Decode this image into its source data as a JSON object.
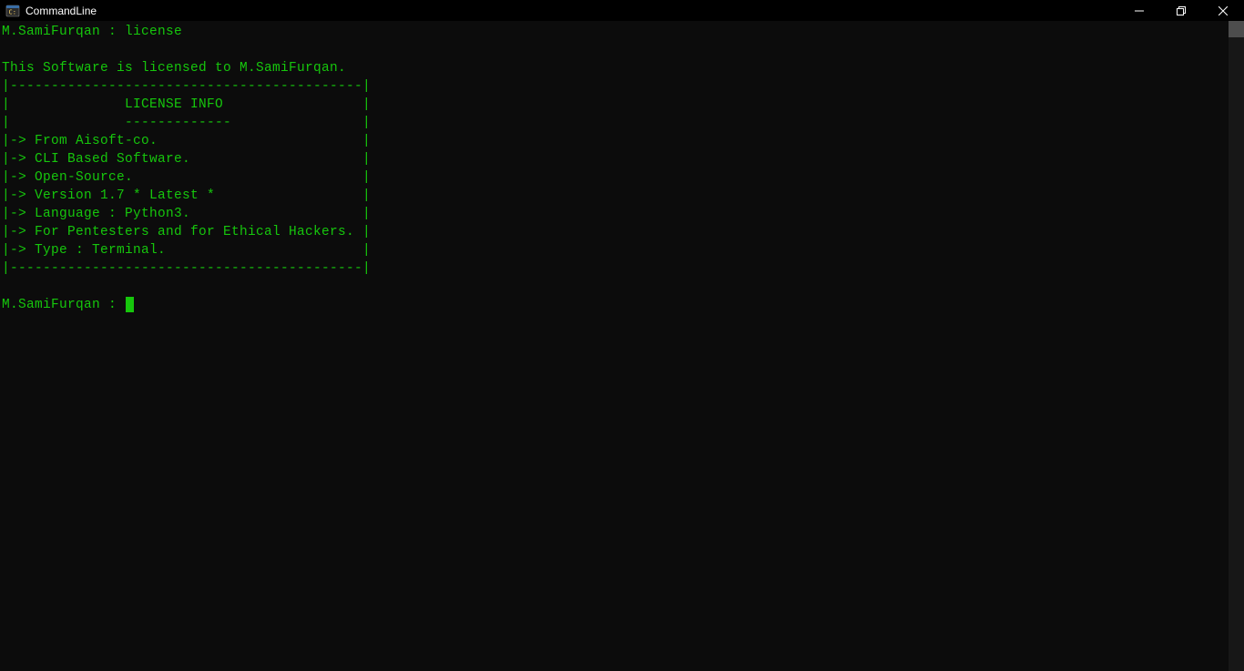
{
  "window": {
    "title": "CommandLine"
  },
  "terminal": {
    "prompt_line": "M.SamiFurqan : license",
    "blank1": "",
    "licensed_to": "This Software is licensed to M.SamiFurqan.",
    "box_top": "|-------------------------------------------|",
    "box_header": "|              LICENSE INFO                 |",
    "box_sep": "|              -------------                |",
    "box_l1": "|-> From Aisoft-co.                         |",
    "box_l2": "|-> CLI Based Software.                     |",
    "box_l3": "|-> Open-Source.                            |",
    "box_l4": "|-> Version 1.7 * Latest *                  |",
    "box_l5": "|-> Language : Python3.                     |",
    "box_l6": "|-> For Pentesters and for Ethical Hackers. |",
    "box_l7": "|-> Type : Terminal.                        |",
    "box_bottom": "|-------------------------------------------|",
    "blank2": "",
    "prompt2": "M.SamiFurqan : "
  }
}
